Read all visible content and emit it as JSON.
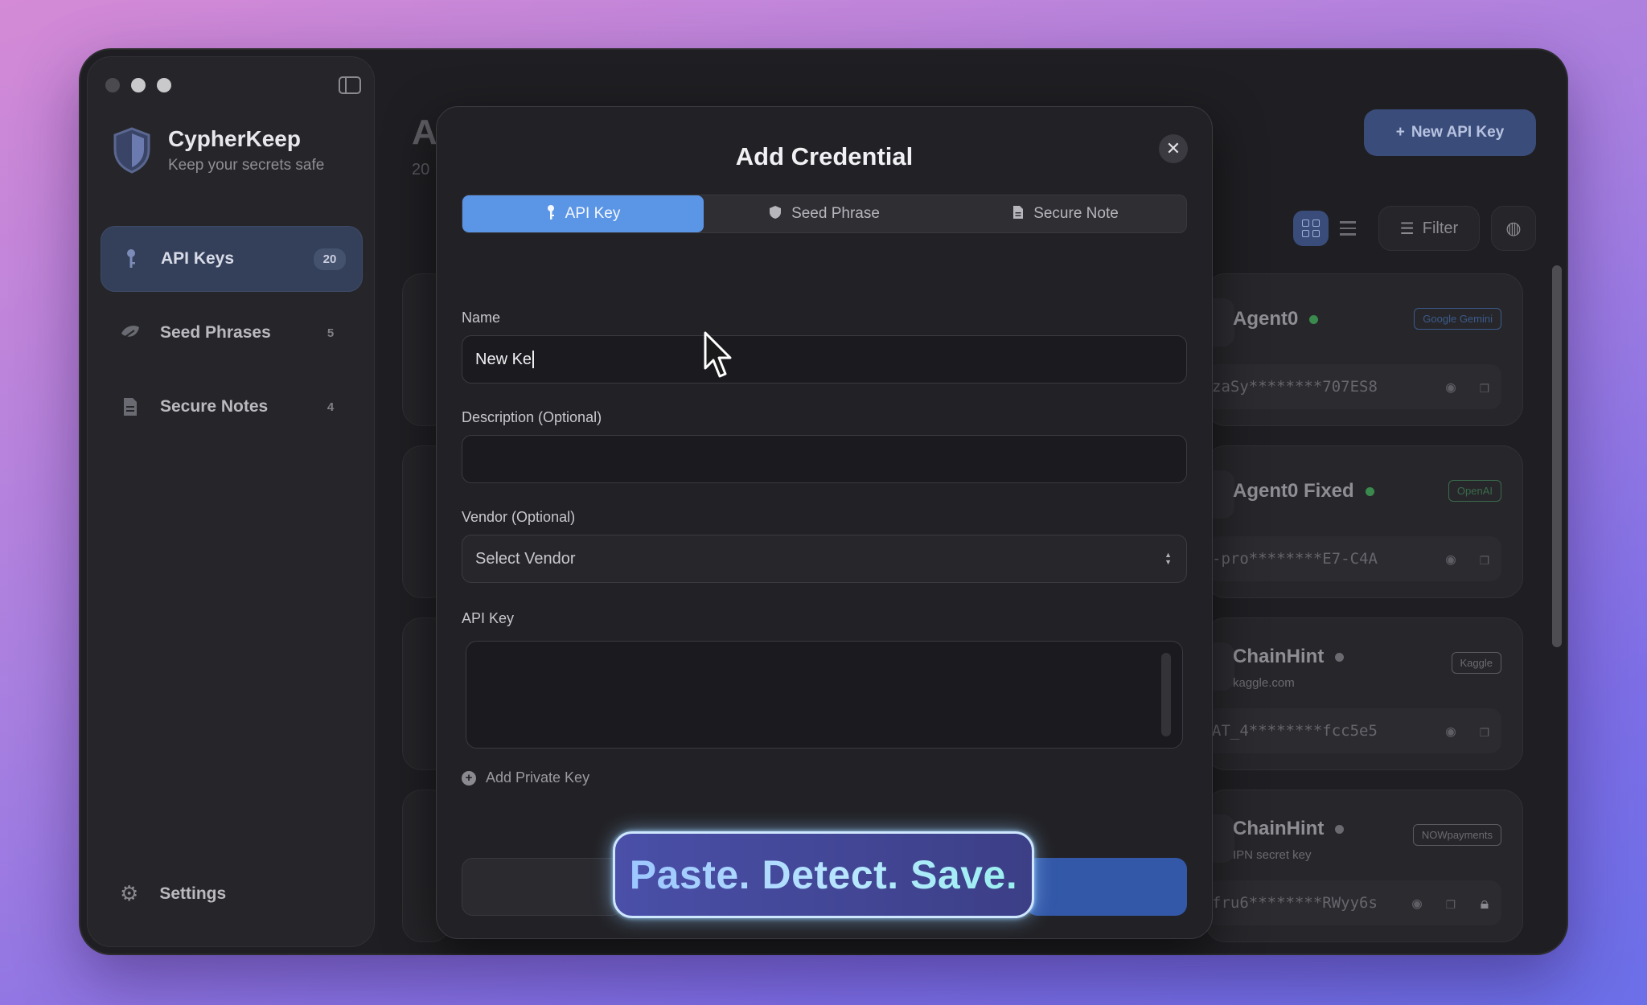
{
  "sidebar": {
    "brand_title": "CypherKeep",
    "brand_subtitle": "Keep your secrets safe",
    "items": [
      {
        "label": "API Keys",
        "count": "20",
        "icon": "key-icon",
        "active": true
      },
      {
        "label": "Seed Phrases",
        "count": "5",
        "icon": "leaf-icon",
        "active": false
      },
      {
        "label": "Secure Notes",
        "count": "4",
        "icon": "document-icon",
        "active": false
      }
    ],
    "settings_label": "Settings"
  },
  "main": {
    "title_partial": "A",
    "subtitle_partial": "20",
    "new_key_button": "New API Key",
    "filter_label": "Filter",
    "cards": [
      {
        "name": "Agent0",
        "status": "green",
        "badge": "Google Gemini",
        "badge_color": "#3b5a8a",
        "key": "zaSy********707ES8",
        "sub": ""
      },
      {
        "name": "Agent0 Fixed",
        "status": "green",
        "badge": "OpenAI",
        "badge_color": "#3a6a4a",
        "key": "-pro********E7-C4A",
        "sub": ""
      },
      {
        "name": "ChainHint",
        "status": "grey",
        "badge": "Kaggle",
        "badge_color": "#5a5a60",
        "key": "AT_4********fcc5e5",
        "sub": "kaggle.com"
      },
      {
        "name": "ChainHint",
        "status": "grey",
        "badge": "NOWpayments",
        "badge_color": "#5a5a60",
        "key": "fru6********RWyy6s",
        "sub": "IPN secret key"
      }
    ]
  },
  "dialog": {
    "title": "Add Credential",
    "tabs": [
      {
        "label": "API Key",
        "icon": "key-icon",
        "active": true
      },
      {
        "label": "Seed Phrase",
        "icon": "shield-icon",
        "active": false
      },
      {
        "label": "Secure Note",
        "icon": "document-icon",
        "active": false
      }
    ],
    "name_label": "Name",
    "name_value": "New Ke",
    "description_label": "Description (Optional)",
    "description_value": "",
    "vendor_label": "Vendor (Optional)",
    "vendor_value": "Select Vendor",
    "api_key_label": "API Key",
    "add_private_key": "Add Private Key"
  },
  "promo": {
    "text": "Paste. Detect. Save."
  },
  "colors": {
    "accent": "#5b95e6",
    "primary_button": "#3358a8",
    "background": "#1f1f23"
  }
}
